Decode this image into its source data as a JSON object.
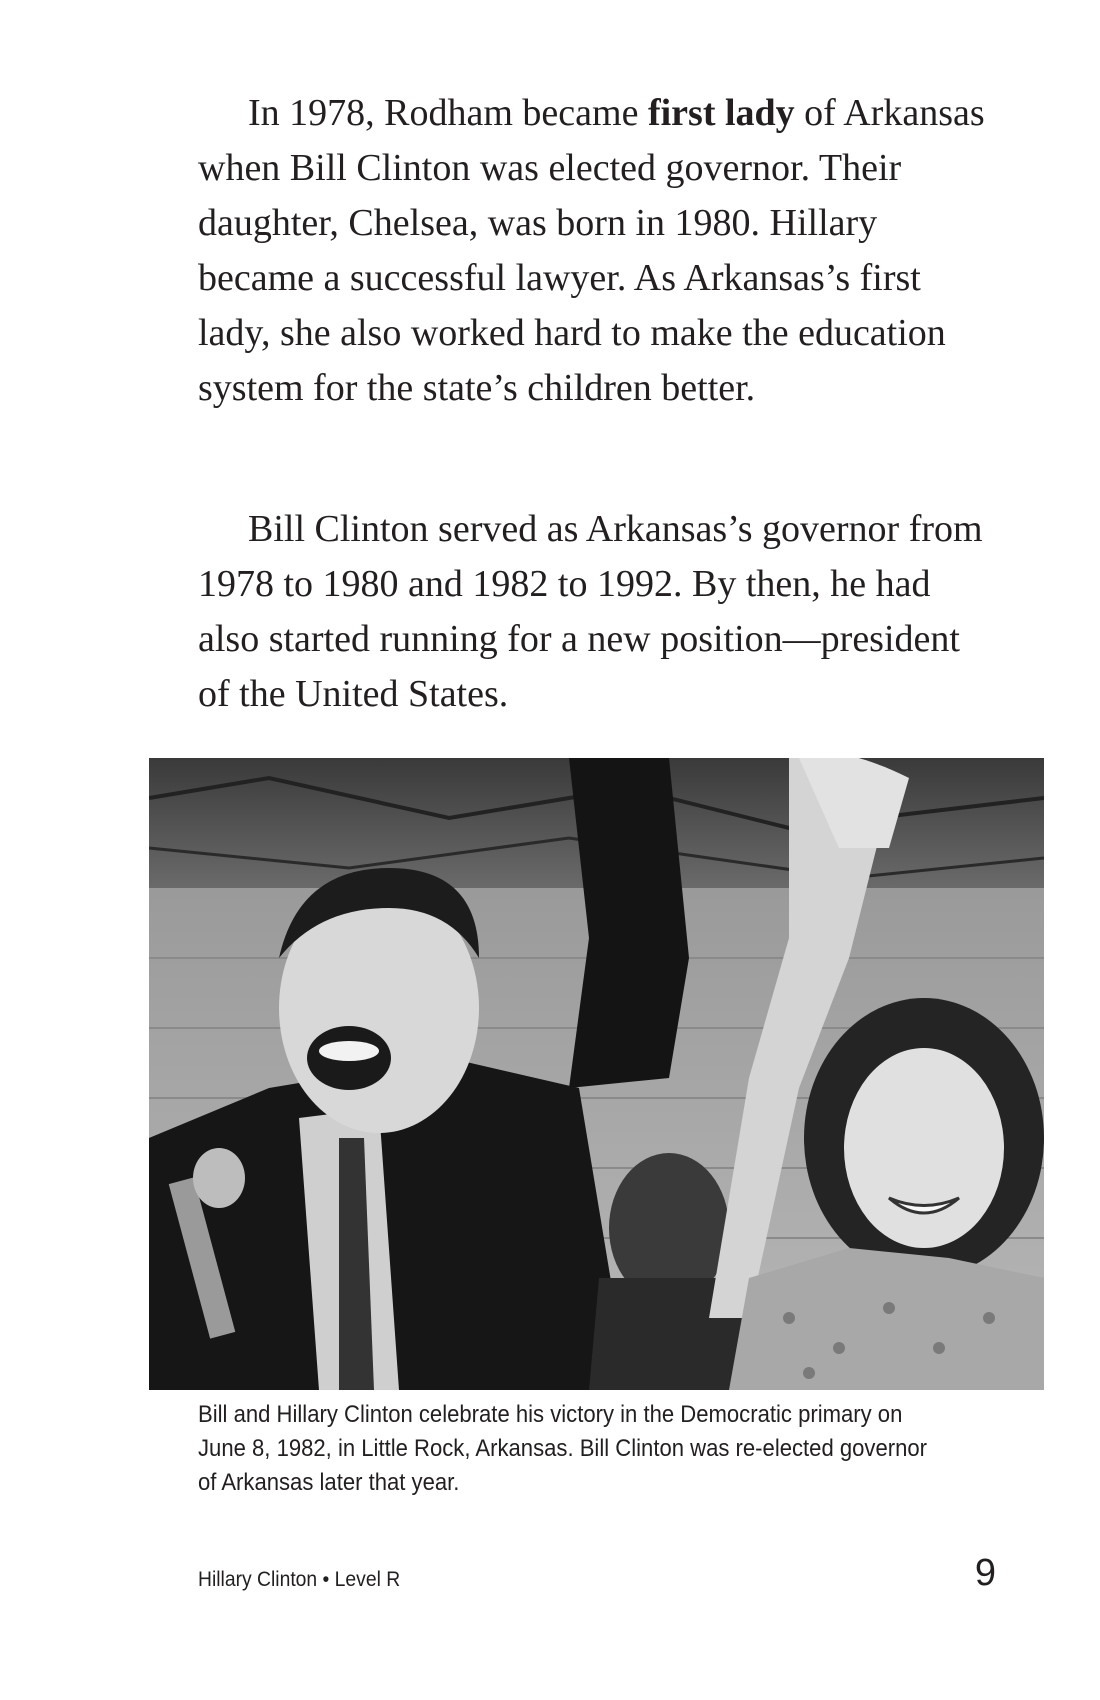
{
  "paragraphs": [
    {
      "before": "In 1978, Rodham became ",
      "bold": "first lady",
      "after": " of Arkansas when Bill Clinton was elected governor. Their daughter, Chelsea, was born in 1980. Hillary became a successful lawyer. As Arkansas’s first lady, she also worked hard to make the education system for the state’s children better."
    },
    {
      "text": "Bill Clinton served as Arkansas’s governor from 1978 to 1980 and 1982 to 1992. By then, he had also started running for a new position—president of the United States."
    }
  ],
  "caption": "Bill and Hillary Clinton celebrate his victory in the Democratic primary on June 8, 1982, in Little Rock, Arkansas. Bill Clinton was re-elected governor of Arkansas later that year.",
  "footer": {
    "title": "Hillary Clinton • Level R",
    "page_number": "9"
  }
}
